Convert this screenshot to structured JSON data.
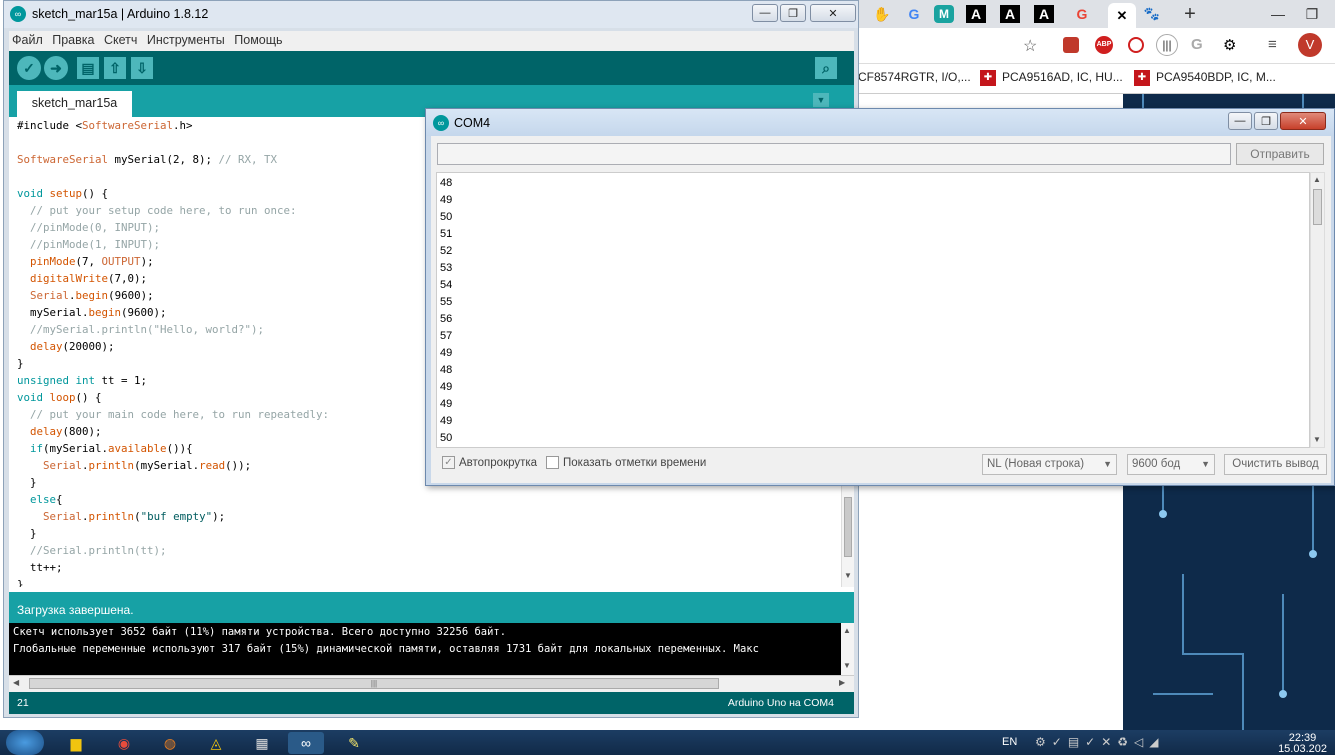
{
  "chrome": {
    "tabs": [
      "G",
      "M",
      "A",
      "A",
      "A",
      "G"
    ],
    "active_close": "✕",
    "new_tab": "+",
    "avatar": "V",
    "bookmarks": [
      "CF8574RGTR, I/O,...",
      "PCA9516AD, IC, HU...",
      "PCA9540BDP, IC, M..."
    ]
  },
  "ide": {
    "title": "sketch_mar15a | Arduino 1.8.12",
    "menu": [
      "Файл",
      "Правка",
      "Скетч",
      "Инструменты",
      "Помощь"
    ],
    "tab": "sketch_mar15a",
    "status": "Загрузка завершена.",
    "console": [
      "Скетч использует 3652 байт (11%) памяти устройства. Всего доступно 32256 байт.",
      "Глобальные переменные используют 317 байт (15%) динамической памяти, оставляя 1731 байт для локальных переменных. Макс"
    ],
    "line_number": "21",
    "board": "Arduino Uno на COM4",
    "code": [
      "#include <SoftwareSerial.h>",
      "",
      "SoftwareSerial mySerial(2, 8); // RX, TX",
      "",
      "void setup() {",
      "  // put your setup code here, to run once:",
      "  //pinMode(0, INPUT);",
      "  //pinMode(1, INPUT);",
      "  pinMode(7, OUTPUT);",
      "  digitalWrite(7,0);",
      "  Serial.begin(9600);",
      "  mySerial.begin(9600);",
      "  //mySerial.println(\"Hello, world?\");",
      "  delay(20000);",
      "}",
      "unsigned int tt = 1;",
      "void loop() {",
      "  // put your main code here, to run repeatedly:",
      "  delay(800);",
      "  if(mySerial.available()){",
      "    Serial.println(mySerial.read());",
      "  }",
      "  else{",
      "    Serial.println(\"buf empty\");",
      "  }",
      "  //Serial.println(tt);",
      "  tt++;",
      "}"
    ]
  },
  "monitor": {
    "title": "COM4",
    "send_label": "Отправить",
    "send_value": "",
    "output": [
      "48",
      "49",
      "50",
      "51",
      "52",
      "53",
      "54",
      "55",
      "56",
      "57",
      "49",
      "48",
      "49",
      "49",
      "49",
      "50"
    ],
    "autoscroll_label": "Автопрокрутка",
    "timestamps_label": "Показать отметки времени",
    "line_ending": "NL (Новая строка)",
    "baud": "9600 бод",
    "clear_label": "Очистить вывод"
  },
  "taskbar": {
    "lang": "EN",
    "time": "22:39",
    "date": "15.03.202"
  }
}
